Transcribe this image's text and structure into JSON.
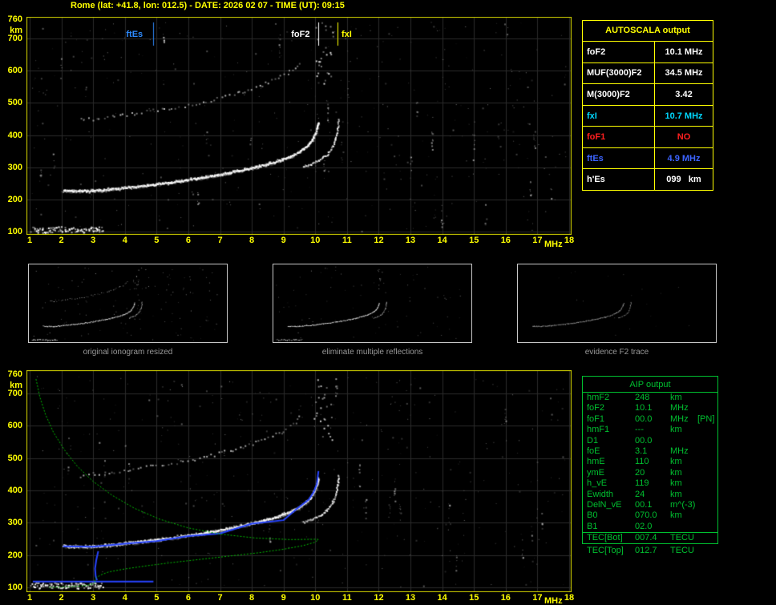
{
  "title": "Rome (lat: +41.8, lon: 012.5) - DATE: 2026 02 07 - TIME (UT): 09:15",
  "autoscala_table": {
    "title": "AUTOSCALA output",
    "rows": [
      {
        "label": "foF2",
        "value": "10.1 MHz",
        "color": "#ffffff"
      },
      {
        "label": "MUF(3000)F2",
        "value": "34.5 MHz",
        "color": "#ffffff"
      },
      {
        "label": "M(3000)F2",
        "value": "3.42",
        "color": "#ffffff"
      },
      {
        "label": "fxI",
        "value": "10.7 MHz",
        "color": "#00d8ff"
      },
      {
        "label": "foF1",
        "value": "NO",
        "color": "#ff2020"
      },
      {
        "label": "ftEs",
        "value": "4.9 MHz",
        "color": "#3c64ff"
      },
      {
        "label": "h'Es",
        "value": "099   km",
        "color": "#ffffff"
      }
    ]
  },
  "aip_table": {
    "title": "AIP output",
    "rows": [
      {
        "name": "hmF2",
        "value": "248",
        "unit": "km",
        "note": ""
      },
      {
        "name": "foF2",
        "value": "10.1",
        "unit": "MHz",
        "note": ""
      },
      {
        "name": "foF1",
        "value": "00.0",
        "unit": "MHz",
        "note": "[PN]"
      },
      {
        "name": "hmF1",
        "value": "---",
        "unit": "km",
        "note": ""
      },
      {
        "name": "D1",
        "value": "00.0",
        "unit": "",
        "note": ""
      },
      {
        "name": "foE",
        "value": "3.1",
        "unit": "MHz",
        "note": ""
      },
      {
        "name": "hmE",
        "value": "110",
        "unit": "km",
        "note": ""
      },
      {
        "name": "ymE",
        "value": "20",
        "unit": "km",
        "note": ""
      },
      {
        "name": "h_vE",
        "value": "119",
        "unit": "km",
        "note": ""
      },
      {
        "name": "Ewidth",
        "value": "24",
        "unit": "km",
        "note": ""
      },
      {
        "name": "DelN_vE",
        "value": "00.1",
        "unit": "m^(-3)",
        "note": ""
      },
      {
        "name": "B0",
        "value": "070.0",
        "unit": "km",
        "note": ""
      },
      {
        "name": "B1",
        "value": "02.0",
        "unit": "",
        "note": ""
      }
    ],
    "tec_rows": [
      {
        "name": "TEC[Bot]",
        "value": "007.4",
        "unit": "TECU",
        "note": ""
      },
      {
        "name": "TEC[Top]",
        "value": "012.7",
        "unit": "TECU",
        "note": ""
      }
    ]
  },
  "thumbnails": [
    {
      "caption": "original ionogram resized"
    },
    {
      "caption": "eliminate multiple reflections"
    },
    {
      "caption": "evidence F2 trace"
    }
  ],
  "chart_data": {
    "type": "scatter",
    "title": "Ionogram with autoscaled traces and electron density profile",
    "xlabel": "MHz",
    "ylabel": "km",
    "xlim": [
      1,
      18
    ],
    "ylim": [
      100,
      760
    ],
    "grid": true,
    "x_ticks": [
      1,
      2,
      3,
      4,
      5,
      6,
      7,
      8,
      9,
      10,
      11,
      12,
      13,
      14,
      15,
      16,
      17,
      18
    ],
    "y_ticks": [
      760,
      700,
      600,
      500,
      400,
      300,
      200,
      100
    ],
    "markers": [
      {
        "label": "ftEs",
        "f": 4.9,
        "color": "#2e8bff"
      },
      {
        "label": "foF2",
        "f": 10.1,
        "color": "#ffffff"
      },
      {
        "label": "fxI",
        "f": 10.7,
        "color": "#ffff00"
      }
    ],
    "series": [
      {
        "name": "F2_ordinary_trace",
        "color": "#ffffff",
        "points": [
          [
            2.05,
            230
          ],
          [
            2.4,
            228
          ],
          [
            2.8,
            228
          ],
          [
            3.2,
            230
          ],
          [
            3.6,
            234
          ],
          [
            4.0,
            238
          ],
          [
            4.4,
            242
          ],
          [
            4.8,
            247
          ],
          [
            5.2,
            252
          ],
          [
            5.6,
            257
          ],
          [
            6.0,
            263
          ],
          [
            6.4,
            269
          ],
          [
            6.8,
            276
          ],
          [
            7.2,
            283
          ],
          [
            7.6,
            291
          ],
          [
            8.0,
            300
          ],
          [
            8.4,
            310
          ],
          [
            8.8,
            321
          ],
          [
            9.1,
            332
          ],
          [
            9.4,
            345
          ],
          [
            9.6,
            358
          ],
          [
            9.8,
            375
          ],
          [
            9.92,
            393
          ],
          [
            10.0,
            410
          ],
          [
            10.05,
            425
          ],
          [
            10.09,
            443
          ]
        ]
      },
      {
        "name": "F2_extraordinary_trace",
        "color": "#ffffff",
        "points": [
          [
            9.6,
            303
          ],
          [
            9.9,
            313
          ],
          [
            10.15,
            326
          ],
          [
            10.35,
            341
          ],
          [
            10.5,
            359
          ],
          [
            10.6,
            381
          ],
          [
            10.66,
            404
          ],
          [
            10.7,
            428
          ],
          [
            10.72,
            452
          ]
        ]
      },
      {
        "name": "multiple_reflection_trace",
        "color": "#aaaaaa",
        "points": [
          [
            2.6,
            448
          ],
          [
            3.2,
            455
          ],
          [
            3.8,
            462
          ],
          [
            4.4,
            470
          ],
          [
            5.0,
            479
          ],
          [
            5.6,
            489
          ],
          [
            6.2,
            500
          ],
          [
            6.8,
            513
          ],
          [
            7.4,
            528
          ],
          [
            8.0,
            546
          ],
          [
            8.5,
            565
          ],
          [
            9.0,
            588
          ],
          [
            9.35,
            612
          ],
          [
            9.6,
            636
          ]
        ]
      },
      {
        "name": "Es_trace",
        "color": "#ffffff",
        "points": [
          [
            1.05,
            108
          ],
          [
            1.5,
            106
          ],
          [
            2.0,
            108
          ],
          [
            2.5,
            106
          ],
          [
            2.9,
            108
          ],
          [
            3.3,
            107
          ]
        ]
      },
      {
        "name": "electron_density_profile",
        "color": "#00c000",
        "points": [
          [
            1.2,
            745
          ],
          [
            1.32,
            690
          ],
          [
            1.5,
            635
          ],
          [
            1.75,
            580
          ],
          [
            2.1,
            525
          ],
          [
            2.5,
            475
          ],
          [
            3.0,
            428
          ],
          [
            3.6,
            385
          ],
          [
            4.3,
            345
          ],
          [
            5.1,
            311
          ],
          [
            6.0,
            284
          ],
          [
            7.0,
            265
          ],
          [
            8.1,
            253
          ],
          [
            9.2,
            248
          ],
          [
            10.05,
            249
          ],
          [
            10.1,
            248
          ],
          [
            10.0,
            240
          ],
          [
            9.6,
            229
          ],
          [
            9.0,
            218
          ],
          [
            8.2,
            207
          ],
          [
            7.3,
            197
          ],
          [
            6.4,
            187
          ],
          [
            5.5,
            177
          ],
          [
            4.7,
            167
          ],
          [
            4.0,
            157
          ],
          [
            3.5,
            148
          ],
          [
            3.25,
            139
          ],
          [
            3.1,
            130
          ],
          [
            3.05,
            122
          ],
          [
            3.08,
            116
          ],
          [
            3.0,
            111
          ],
          [
            2.8,
            106
          ],
          [
            2.45,
            103
          ],
          [
            2.0,
            101
          ],
          [
            1.6,
            100
          ]
        ]
      },
      {
        "name": "autoscala_restored_trace",
        "color": "#2744ff",
        "points": [
          [
            2.05,
            232
          ],
          [
            3.0,
            231
          ],
          [
            4.0,
            240
          ],
          [
            5.0,
            248
          ],
          [
            6.0,
            264
          ],
          [
            7.0,
            272
          ],
          [
            8.0,
            302
          ],
          [
            9.0,
            313
          ],
          [
            9.4,
            347
          ],
          [
            9.8,
            377
          ],
          [
            9.95,
            400
          ],
          [
            10.05,
            425
          ],
          [
            10.1,
            465
          ]
        ]
      },
      {
        "name": "restored_Es",
        "color": "#2744ff",
        "points": [
          [
            1.1,
            118
          ],
          [
            4.9,
            118
          ]
        ]
      },
      {
        "name": "restored_valley",
        "color": "#2744ff",
        "points": [
          [
            3.16,
            212
          ],
          [
            3.1,
            185
          ],
          [
            3.06,
            158
          ],
          [
            3.08,
            135
          ],
          [
            3.12,
            122
          ]
        ]
      }
    ]
  }
}
